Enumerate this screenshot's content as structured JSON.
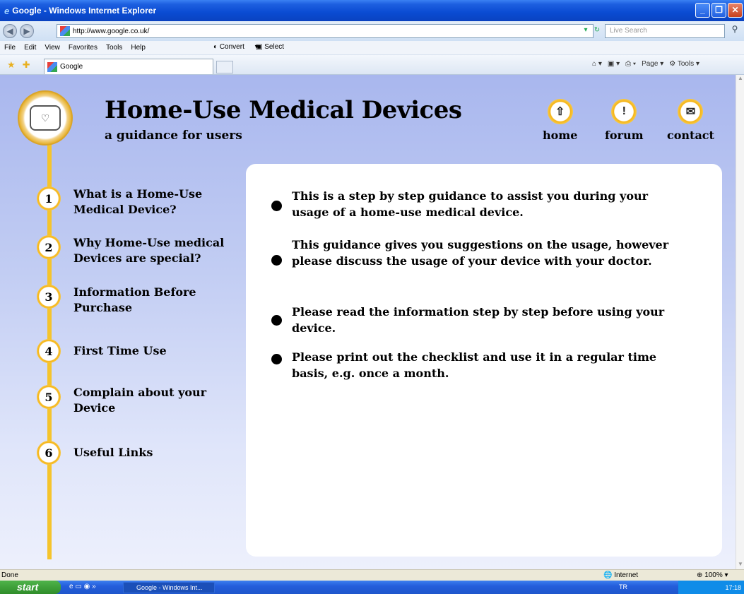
{
  "window": {
    "title": "Google - Windows Internet Explorer"
  },
  "address": {
    "url": "http://www.google.co.uk/",
    "search_placeholder": "Live Search"
  },
  "menu": {
    "items": [
      "File",
      "Edit",
      "View",
      "Favorites",
      "Tools",
      "Help"
    ],
    "convert": "Convert",
    "select": "Select"
  },
  "tab": {
    "title": "Google"
  },
  "commandbar": {
    "page": "Page",
    "tools": "Tools"
  },
  "site": {
    "title": "Home-Use Medical Devices",
    "subtitle": "a guidance for users"
  },
  "topnav": [
    {
      "label": "home",
      "icon": "home-icon"
    },
    {
      "label": "forum",
      "icon": "exclamation-icon"
    },
    {
      "label": "contact",
      "icon": "envelope-icon"
    }
  ],
  "sidebar": {
    "items": [
      {
        "num": "1",
        "label": "What is a Home-Use Medical Device?"
      },
      {
        "num": "2",
        "label": "Why Home-Use medical Devices are special?"
      },
      {
        "num": "3",
        "label": "Information Before Purchase"
      },
      {
        "num": "4",
        "label": "First Time Use"
      },
      {
        "num": "5",
        "label": "Complain about your Device"
      },
      {
        "num": "6",
        "label": "Useful Links"
      }
    ]
  },
  "content": {
    "bullets": [
      "This is a step by step guidance to assist you during your usage of a home-use medical device.",
      "This guidance gives you suggestions on the usage, however please discuss the usage of your device with your doctor.",
      "Please read the information step by step before using your device.",
      "Please print out the checklist and use it in a regular time basis, e.g. once a month."
    ]
  },
  "status": {
    "text": "Done",
    "zone": "Internet",
    "zoom": "100%"
  },
  "taskbar": {
    "start": "start",
    "task": "Google - Windows Int...",
    "lang": "TR",
    "clock": "17:18"
  },
  "colors": {
    "accent_yellow": "#f5c42c",
    "page_bg": "#a9b7ee",
    "content_bg": "#ffffff"
  }
}
